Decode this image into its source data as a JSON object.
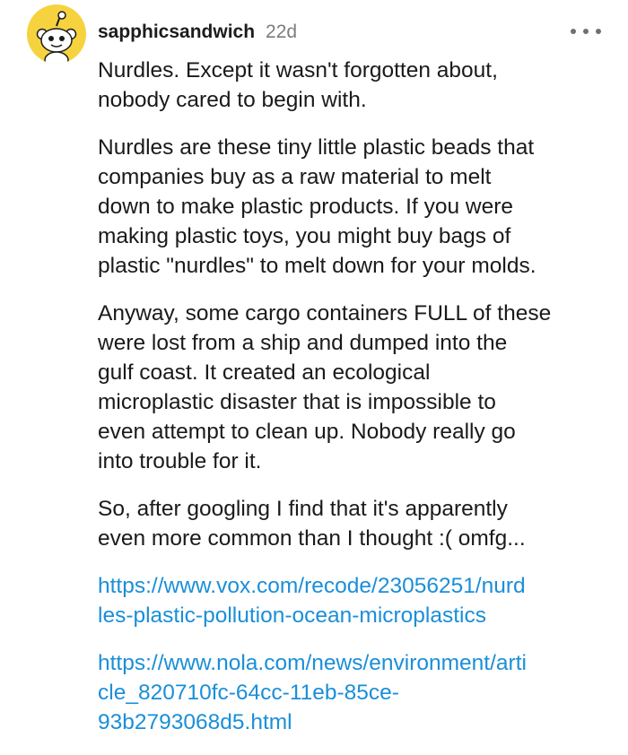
{
  "comment": {
    "username": "sapphicsandwich",
    "age": "22d",
    "avatar_icon": "snoo-avatar-icon",
    "more_icon": "more-options-icon",
    "colors": {
      "avatar_bg": "#f6d33e",
      "link": "#1a8fd8",
      "meta": "#7c7c7c"
    },
    "paragraphs": [
      [
        "Nurdles. Except it wasn't forgotten about,",
        "nobody cared to begin with."
      ],
      [
        "Nurdles are these tiny little plastic beads that",
        "companies buy as a raw material to melt",
        "down to make plastic products. If you were",
        "making plastic toys, you might buy bags of",
        "plastic \"nurdles\" to melt down for your molds."
      ],
      [
        "Anyway, some cargo containers FULL of these",
        "were lost from a ship and dumped into the",
        "gulf coast. It created an ecological",
        "microplastic disaster that is impossible to",
        "even attempt to clean up. Nobody really go",
        "into trouble for it."
      ],
      [
        "So, after googling I find that it's apparently",
        "even more common than I thought :( omfg..."
      ]
    ],
    "links": [
      [
        "https://www.vox.com/recode/23056251/nurd",
        "les-plastic-pollution-ocean-microplastics"
      ],
      [
        "https://www.nola.com/news/environment/arti",
        "cle_820710fc-64cc-11eb-85ce-",
        "93b2793068d5.html"
      ]
    ]
  }
}
